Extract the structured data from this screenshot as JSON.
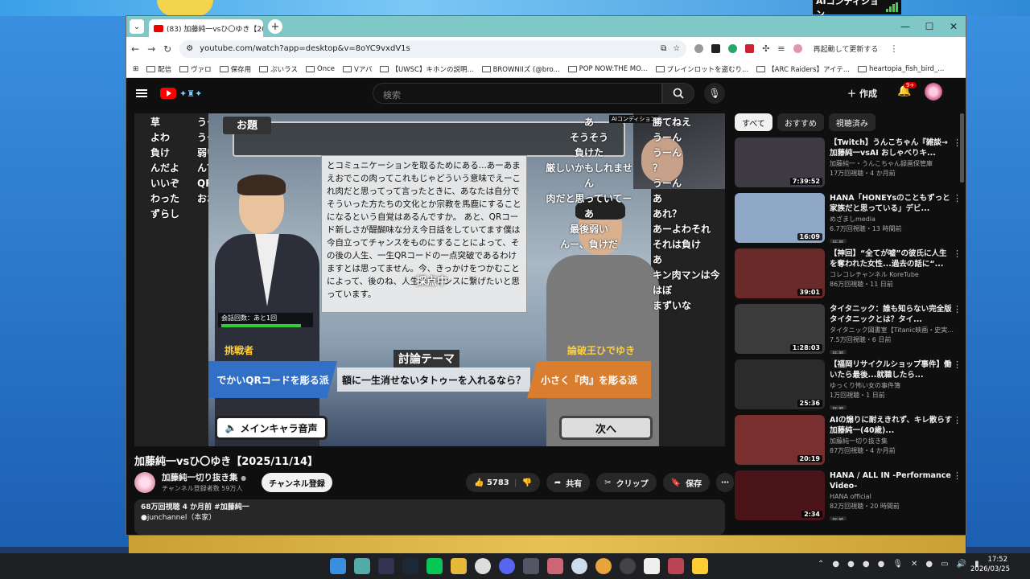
{
  "overlay": {
    "top_right_label": "AIコンディション"
  },
  "browser": {
    "tab_title": "(83) 加藤純一vsひ〇ゆき【20:",
    "url": "youtube.com/watch?app=desktop&v=8oYC9vxdV1s",
    "restart_label": "再起動して更新する",
    "bookmarks": [
      "配信",
      "ヴァロ",
      "保存用",
      "ぷいラス",
      "Once",
      "Vアバ",
      "【UWSC】キホンの説明...",
      "BROWNIIズ (@bro...",
      "POP NOW:THE MO...",
      "ブレインロットを盗むり...",
      "【ARC Raiders】アイテ...",
      "heartopia_fish_bird_..."
    ]
  },
  "youtube": {
    "search_placeholder": "検索",
    "create_label": "作成",
    "notif_count": "9+",
    "video_title": "加藤純一vsひ〇ゆき【2025/11/14】",
    "channel_name": "加藤純一切り抜き集",
    "channel_subs": "チャンネル登録者数 59万人",
    "subscribe_label": "チャンネル登録",
    "likes": "5783",
    "share_label": "共有",
    "clip_label": "クリップ",
    "save_label": "保存",
    "desc_meta": "68万回視聴  4 か月前  #加藤純一",
    "desc_line2": "●junchannel（本家）",
    "chips": [
      "すべて",
      "おすすめ",
      "視聴済み"
    ],
    "recs": [
      {
        "title": "【Twitch】うんこちゃん『雑談→加藤純一vsAI おしゃべりキ...",
        "channel": "加藤純一・うんこちゃん録画保管庫",
        "meta": "17万回視聴・4 か月前",
        "dur": "7:39:52",
        "new": ""
      },
      {
        "title": "HANA「HONEYsのこともずっと家族だと思っている」デビ...",
        "channel": "めざましmedia",
        "meta": "6.7万回視聴・13 時間前",
        "dur": "16:09",
        "new": "新着"
      },
      {
        "title": "【神回】“全てが嘘”の彼氏に人生を奪われた女性...過去の話に“...",
        "channel": "コレコレチャンネル KoreTube",
        "meta": "86万回視聴・11 日前",
        "dur": "39:01",
        "new": ""
      },
      {
        "title": "タイタニック：誰も知らない完全版タイタニックとは？タイ...",
        "channel": "タイタニック図書室【Titanic映画・史実...",
        "meta": "7.5万回視聴・6 日前",
        "dur": "1:28:03",
        "new": "新着"
      },
      {
        "title": "【福岡リサイクルショップ事件】働いたら最後...就職したら...",
        "channel": "ゆっくり怖い女の事件簿",
        "meta": "1万回視聴・1 日前",
        "dur": "25:36",
        "new": "新着"
      },
      {
        "title": "AIの煽りに耐えきれず、キレ散らす加藤純一(40歳)...",
        "channel": "加藤純一切り抜き集",
        "meta": "87万回視聴・4 か月前",
        "dur": "20:19",
        "new": ""
      },
      {
        "title": "HANA / ALL IN -Performance Video-",
        "channel": "HANA official",
        "meta": "82万回視聴・20 時間前",
        "dur": "2:34",
        "new": "新着"
      }
    ]
  },
  "stream": {
    "odai": "お題",
    "main_voice": "メインキャラ音声",
    "next_label": "次へ",
    "theme_label": "討論テーマ",
    "question": "額に一生消せないタトゥーを入れるなら？",
    "left_side": "でかいQRコードを彫る派",
    "right_side": "小さく『肉』を彫る派",
    "challenger": "挑戦者",
    "opponent": "論破王ひでゆき",
    "round_info": "会話回数：あと1回",
    "loading": "採点中",
    "cam_label": "AIコンディション",
    "panel_text": "とコミュニケーションを取るためにある...あーあまえおでこの肉ってこれもじゃどういう意味でえーこれ肉だと思ってって言ったときに、あなたは自分でそういった方たちの文化とか宗教を馬鹿にすることになるという自覚はあるんですか。 あと、QRコード新しさが醍醐味な分え今日話をしていてます僕は今自立ってチャンスをものにすることによって、その後の人生、一生QRコードの一点突破であるわけますとは思ってません。今、きっかけをつかむことによって、後のね、人生のチャンスに繋げたいと思っています。",
    "chat_left": [
      "草",
      "よわ",
      "負け",
      "んだよ",
      "いいぞ",
      "わった",
      "ずらし"
    ],
    "chat_left2": [
      "うーん",
      "うーん",
      "弱い",
      "ん？",
      "QRで勝て",
      "おおおお"
    ],
    "chat_right": [
      "勝てねえ",
      "うーん",
      "うーん",
      "？",
      "うーん",
      "あ",
      "あれ？",
      "あーよわそれ",
      "それは負け",
      "あ",
      "キン肉マンは今はぼ",
      "まずいな"
    ],
    "chat_mid": [
      "あ",
      "そうそう",
      "負けた",
      "厳しいかもしれません",
      "肉だと思っていてー",
      "あ",
      "最後弱い",
      "んー、負けだ"
    ]
  },
  "taskbar": {
    "time": "17:52",
    "date": "2026/03/25"
  }
}
